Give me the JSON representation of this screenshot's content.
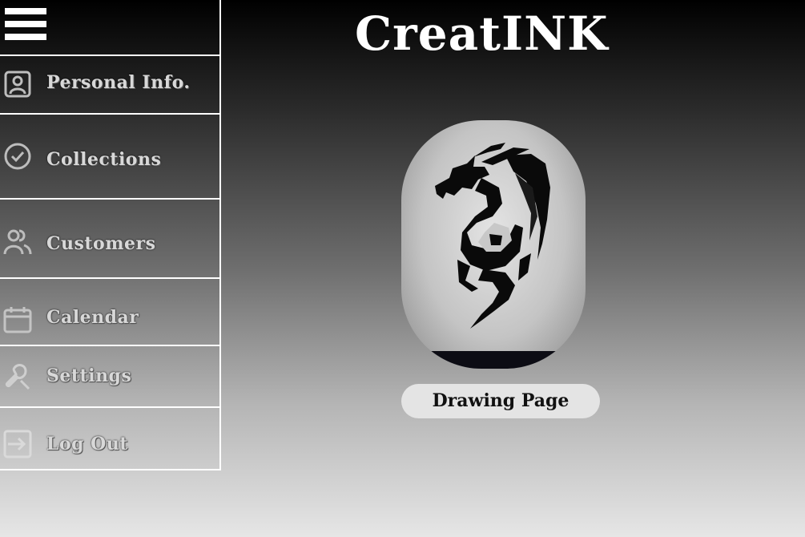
{
  "app": {
    "title": "CreatINK"
  },
  "sidebar": {
    "menu_icon": "hamburger-icon",
    "items": [
      {
        "label": "Personal Info.",
        "icon": "id-card-icon"
      },
      {
        "label": "Collections",
        "icon": "check-circle-icon"
      },
      {
        "label": "Customers",
        "icon": "users-icon"
      },
      {
        "label": "Calendar",
        "icon": "calendar-icon"
      },
      {
        "label": "Settings",
        "icon": "wrench-icon"
      },
      {
        "label": "Log Out",
        "icon": "logout-icon"
      }
    ]
  },
  "main": {
    "artwork_icon": "dragon-tattoo-image",
    "drawing_button_label": "Drawing Page"
  },
  "colors": {
    "accent": "#ffffff",
    "button_bg": "#e4e4e4",
    "text_dark": "#111111"
  }
}
